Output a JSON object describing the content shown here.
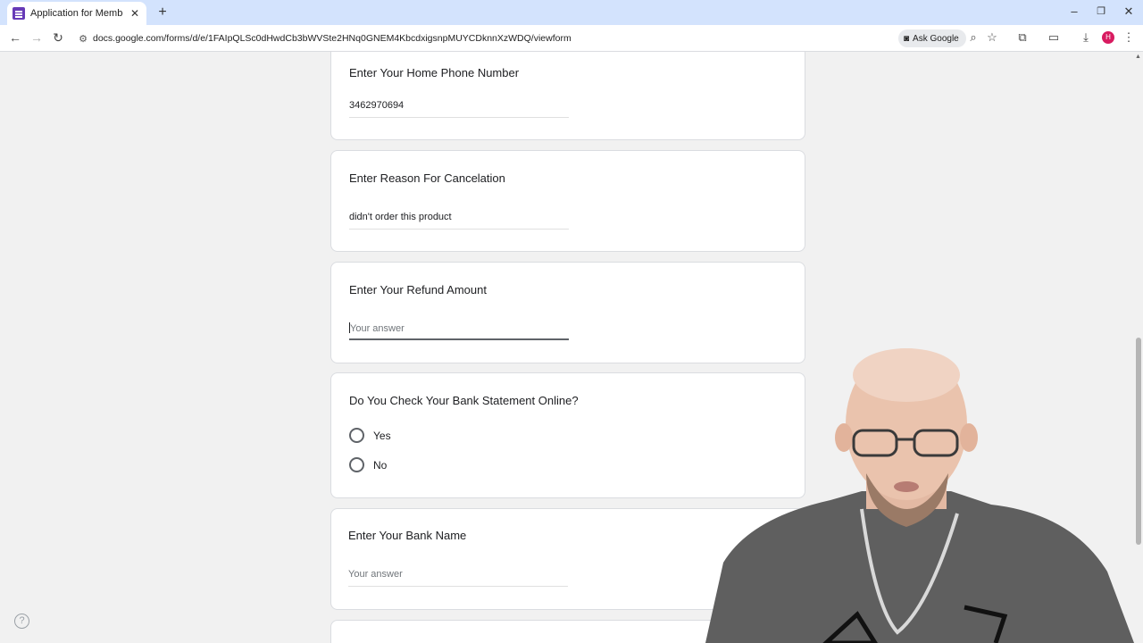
{
  "browser": {
    "tab_title": "Application for Membership Ca",
    "url": "docs.google.com/forms/d/e/1FAIpQLSc0dHwdCb3bWVSte2HNq0GNEM4KbcdxigsnpMUYCDknnXzWDQ/viewform",
    "ask_google_label": "Ask Google",
    "profile_initial": "H"
  },
  "form": {
    "home_phone": {
      "title": "Enter Your Home Phone Number",
      "value": "3462970694"
    },
    "reason": {
      "title": "Enter Reason For Cancelation",
      "value": "didn't order this product"
    },
    "refund": {
      "title": "Enter Your Refund Amount",
      "placeholder": "Your answer"
    },
    "bank_statement": {
      "title": "Do You Check Your Bank Statement Online?",
      "options": [
        "Yes",
        "No"
      ]
    },
    "bank_name": {
      "title": "Enter Your Bank Name",
      "placeholder": "Your answer"
    }
  },
  "colors": {
    "accent": "#673ab7",
    "tabstrip": "#d3e3fd",
    "page_bg": "#f1f1f1"
  }
}
